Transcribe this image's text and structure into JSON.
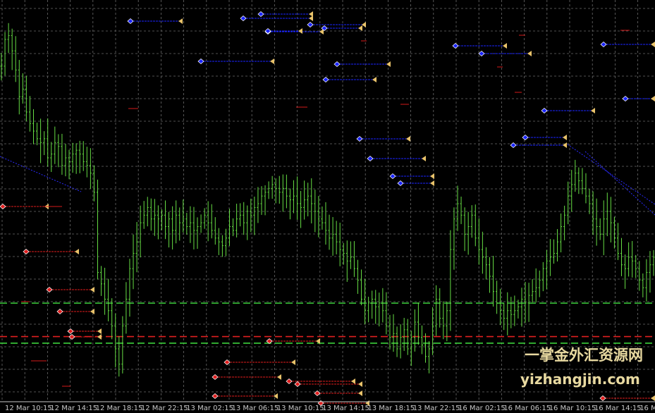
{
  "chart_data": {
    "type": "candlestick",
    "x_ticks": [
      "12 Mar 10:15",
      "12 Mar 14:15",
      "12 Mar 18:15",
      "12 Mar 22:15",
      "13 Mar 02:15",
      "13 Mar 06:15",
      "13 Mar 10:15",
      "13 Mar 14:15",
      "13 Mar 18:15",
      "13 Mar 22:15",
      "16 Mar 02:15",
      "16 Mar 06:15",
      "16 Mar 10:15",
      "16 Mar 14:15",
      "16 Ma"
    ],
    "bar_color": "#66dd44",
    "grid": true,
    "horizontal_levels": [
      {
        "style": "dashed",
        "color": "#3ccf3c",
        "y_frac": 0.734
      },
      {
        "style": "dashed",
        "color": "#e02020",
        "y_frac": 0.815
      },
      {
        "style": "dashed",
        "color": "#3ccf3c",
        "y_frac": 0.831
      }
    ],
    "closes": [
      0.86,
      0.93,
      0.94,
      0.9,
      0.85,
      0.78,
      0.8,
      0.74,
      0.71,
      0.69,
      0.67,
      0.66,
      0.67,
      0.62,
      0.63,
      0.66,
      0.65,
      0.6,
      0.62,
      0.61,
      0.63,
      0.64,
      0.63,
      0.61,
      0.6,
      0.58,
      0.53,
      0.32,
      0.29,
      0.25,
      0.22,
      0.18,
      0.12,
      0.08,
      0.18,
      0.25,
      0.33,
      0.37,
      0.4,
      0.45,
      0.47,
      0.49,
      0.46,
      0.47,
      0.46,
      0.47,
      0.44,
      0.46,
      0.43,
      0.47,
      0.45,
      0.46,
      0.44,
      0.45,
      0.43,
      0.44,
      0.45,
      0.47,
      0.45,
      0.43,
      0.41,
      0.4,
      0.39,
      0.41,
      0.44,
      0.43,
      0.46,
      0.47,
      0.45,
      0.48,
      0.47,
      0.49,
      0.5,
      0.52,
      0.53,
      0.54,
      0.55,
      0.54,
      0.53,
      0.54,
      0.52,
      0.51,
      0.52,
      0.5,
      0.49,
      0.51,
      0.52,
      0.5,
      0.48,
      0.46,
      0.45,
      0.43,
      0.41,
      0.42,
      0.4,
      0.38,
      0.37,
      0.35,
      0.36,
      0.33,
      0.3,
      0.25,
      0.22,
      0.24,
      0.25,
      0.23,
      0.24,
      0.22,
      0.18,
      0.15,
      0.16,
      0.12,
      0.15,
      0.17,
      0.12,
      0.15,
      0.19,
      0.15,
      0.13,
      0.1,
      0.12,
      0.18,
      0.25,
      0.2,
      0.18,
      0.22,
      0.38,
      0.46,
      0.5,
      0.47,
      0.42,
      0.44,
      0.47,
      0.41,
      0.38,
      0.36,
      0.34,
      0.31,
      0.27,
      0.24,
      0.22,
      0.2,
      0.22,
      0.21,
      0.22,
      0.23,
      0.25,
      0.24,
      0.26,
      0.27,
      0.28,
      0.3,
      0.33,
      0.35,
      0.36,
      0.37,
      0.4,
      0.44,
      0.47,
      0.52,
      0.55,
      0.58,
      0.56,
      0.54,
      0.52,
      0.5,
      0.46,
      0.44,
      0.42,
      0.46,
      0.48,
      0.45,
      0.41,
      0.37,
      0.34,
      0.33,
      0.36,
      0.35,
      0.33,
      0.3,
      0.28,
      0.32,
      0.34,
      0.36
    ]
  },
  "watermark": {
    "chinese": "一掌金外汇资源网",
    "url": "yizhangjin.com"
  }
}
